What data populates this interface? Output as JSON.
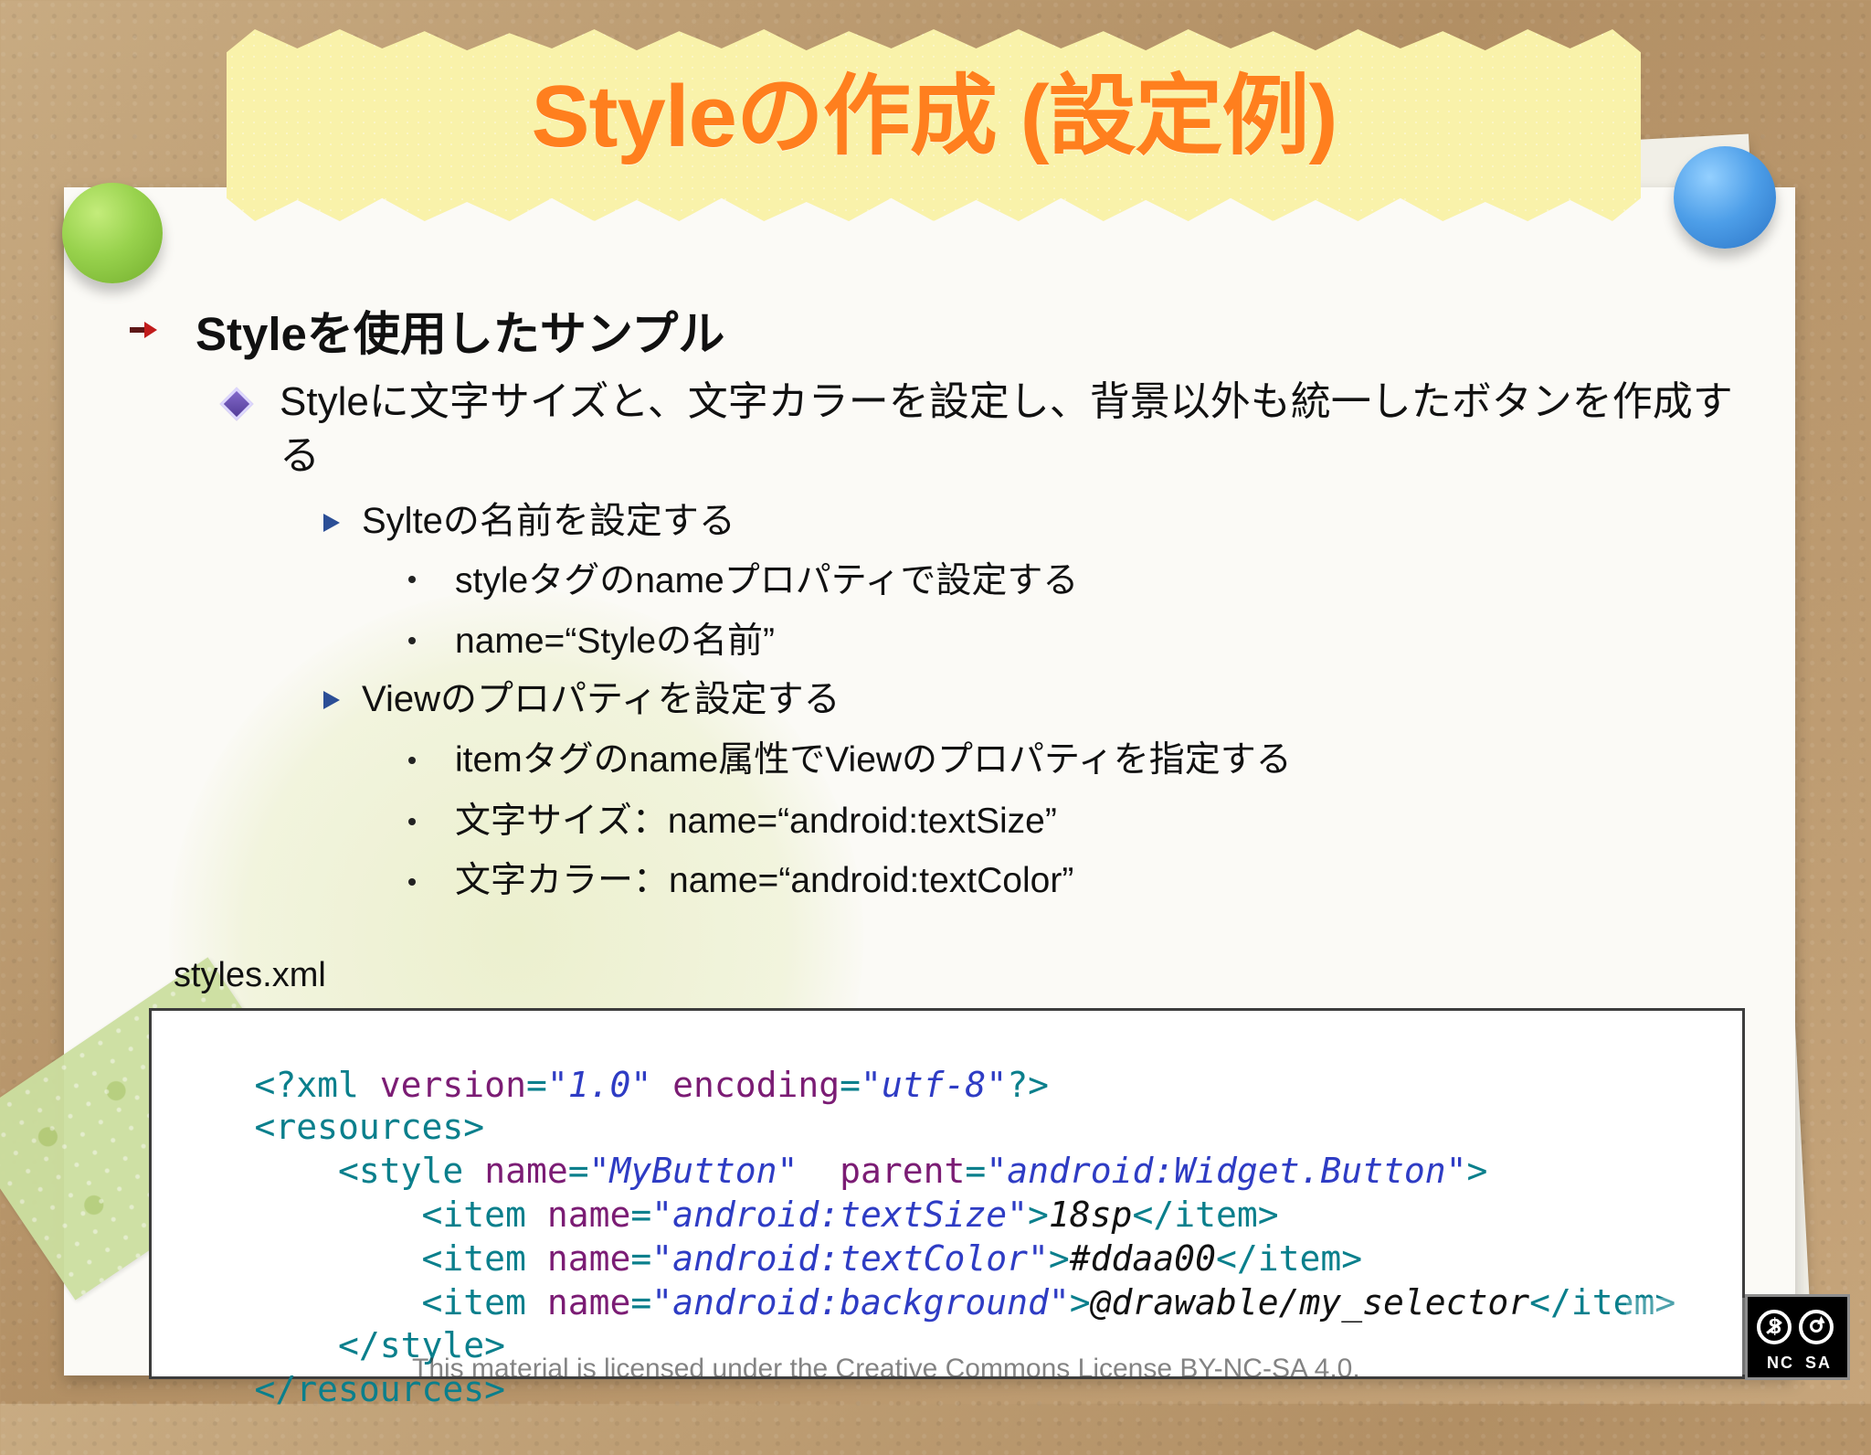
{
  "slide": {
    "title": "Styleの作成 (設定例)",
    "bullets": {
      "level1": "Styleを使用したサンプル",
      "level2": "Styleに文字サイズと、文字カラーを設定し、背景以外も統一したボタンを作成する",
      "level3_1": "Sylteの名前を設定する",
      "level4_1": "styleタグのnameプロパティで設定する",
      "level4_2": "name=“Styleの名前”",
      "level3_2": "Viewのプロパティを設定する",
      "level4_3": "itemタグのname属性でViewのプロパティを指定する",
      "level4_4": "文字サイズ：name=“android:textSize”",
      "level4_5": "文字カラー：name=“android:textColor”"
    },
    "code_caption": "styles.xml",
    "license": "This material is licensed under the Creative Commons License BY-NC-SA 4.0.",
    "badge": {
      "left": "NC",
      "right": "SA"
    },
    "colors": {
      "title": "#ff7f1e",
      "tag": "#0a7f8c",
      "attribute": "#7b1c74",
      "value": "#2e3cc4"
    },
    "icons": {
      "main": "red-arrow-bullet-icon",
      "sub": "purple-diamond-bullet-icon",
      "tertiary": "blue-triangle-bullet-icon",
      "quaternary": "dot-bullet-icon",
      "license": "creative-commons-badge-icon"
    }
  },
  "code": {
    "line1": {
      "p1": "<?xml ",
      "p2": "version",
      "p3": "=",
      "p4": "\"1.0\"",
      "p5": " ",
      "p6": "encoding",
      "p7": "=",
      "p8": "\"utf-8\"",
      "p9": "?>"
    },
    "line2": {
      "p1": "<resources>"
    },
    "line3": {
      "p1": "    <style ",
      "p2": "name",
      "p3": "=",
      "p4": "\"MyButton\"",
      "p5": "  ",
      "p6": "parent",
      "p7": "=",
      "p8": "\"android:Widget.Button\"",
      "p9": ">"
    },
    "line4": {
      "p1": "        <item ",
      "p2": "name",
      "p3": "=",
      "p4": "\"android:textSize\"",
      "p5": ">",
      "p6": "18sp",
      "p7": "</item>"
    },
    "line5": {
      "p1": "        <item ",
      "p2": "name",
      "p3": "=",
      "p4": "\"android:textColor\"",
      "p5": ">",
      "p6": "#ddaa00",
      "p7": "</item>"
    },
    "line6": {
      "p1": "        <item ",
      "p2": "name",
      "p3": "=",
      "p4": "\"android:background\"",
      "p5": ">",
      "p6": "@drawable/my_selector",
      "p7": "</item>"
    },
    "line7": {
      "p1": "    </style>"
    },
    "line8": {
      "p1": "</resources>"
    }
  }
}
